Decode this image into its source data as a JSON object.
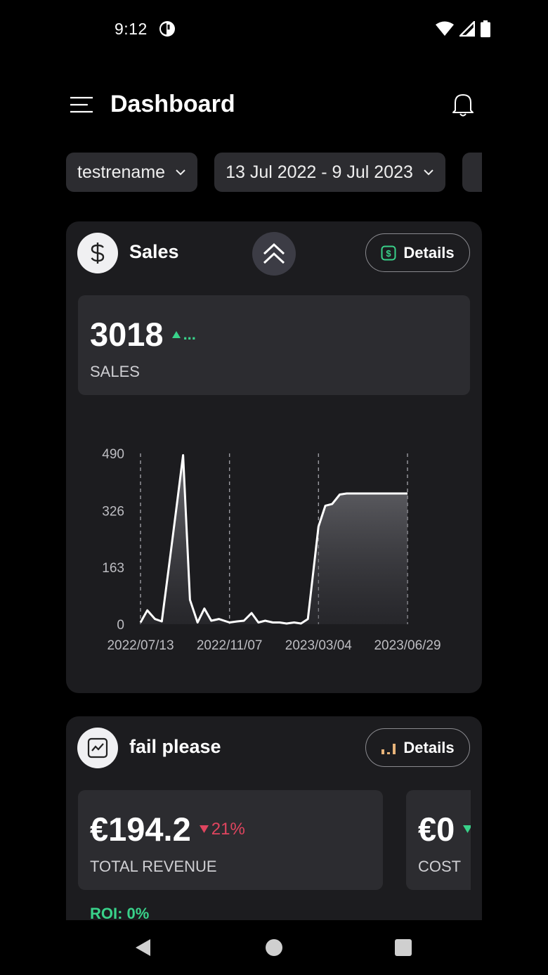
{
  "status_bar": {
    "time": "9:12",
    "icons": [
      "data-saver-icon",
      "wifi-icon",
      "signal-icon",
      "battery-icon"
    ]
  },
  "header": {
    "title": "Dashboard",
    "icons": [
      "menu-icon",
      "bell-icon"
    ]
  },
  "filters": {
    "account": "testrename",
    "date_range": "13 Jul 2022 - 9 Jul 2023"
  },
  "sales_card": {
    "title": "Sales",
    "icon": "dollar-icon",
    "collapse_icon": "double-chevron-up-icon",
    "details_label": "Details",
    "details_icon": "dollar-bill-icon",
    "metric": {
      "value": "3018",
      "label": "SALES",
      "trend": "...",
      "trend_color": "#39d28a"
    }
  },
  "chart_data": {
    "type": "area",
    "title": "",
    "xlabel": "",
    "ylabel": "",
    "y_ticks": [
      "0",
      "163",
      "326",
      "490"
    ],
    "ylim": [
      0,
      490
    ],
    "x_ticks": [
      "2022/07/13",
      "2022/11/07",
      "2023/03/04",
      "2023/06/29"
    ],
    "x": [
      "2022-07-13",
      "2022-07-22",
      "2022-08-01",
      "2022-08-10",
      "2022-08-19",
      "2022-08-29",
      "2022-09-07",
      "2022-09-16",
      "2022-09-26",
      "2022-10-05",
      "2022-10-14",
      "2022-10-24",
      "2022-11-07",
      "2022-11-17",
      "2022-11-26",
      "2022-12-06",
      "2022-12-15",
      "2022-12-24",
      "2023-01-03",
      "2023-01-12",
      "2023-01-21",
      "2023-01-31",
      "2023-02-09",
      "2023-02-18",
      "2023-03-04",
      "2023-03-13",
      "2023-03-22",
      "2023-04-01",
      "2023-04-10",
      "2023-04-19",
      "2023-04-29",
      "2023-05-08",
      "2023-05-17",
      "2023-05-27",
      "2023-06-05",
      "2023-06-14",
      "2023-06-24",
      "2023-06-29"
    ],
    "values": [
      5,
      40,
      15,
      8,
      160,
      330,
      485,
      70,
      5,
      45,
      10,
      15,
      5,
      8,
      10,
      32,
      5,
      10,
      5,
      5,
      2,
      5,
      2,
      15,
      280,
      340,
      345,
      372,
      375,
      375,
      375,
      375,
      375,
      375,
      375,
      375,
      375,
      375
    ],
    "series_color": "#ffffff",
    "grid": "vertical dashed at x ticks"
  },
  "fail_card": {
    "title": "fail please",
    "icon": "trend-chart-icon",
    "details_label": "Details",
    "details_icon": "bar-chart-icon",
    "metrics": [
      {
        "value": "€194.2",
        "label": "TOTAL REVENUE",
        "trend": "21%",
        "trend_color": "#e0455f"
      },
      {
        "value": "€0",
        "label": "COST"
      }
    ],
    "roi": "ROI: 0%"
  },
  "nav_bar": {
    "icons": [
      "back-icon",
      "home-icon",
      "recents-icon"
    ]
  }
}
